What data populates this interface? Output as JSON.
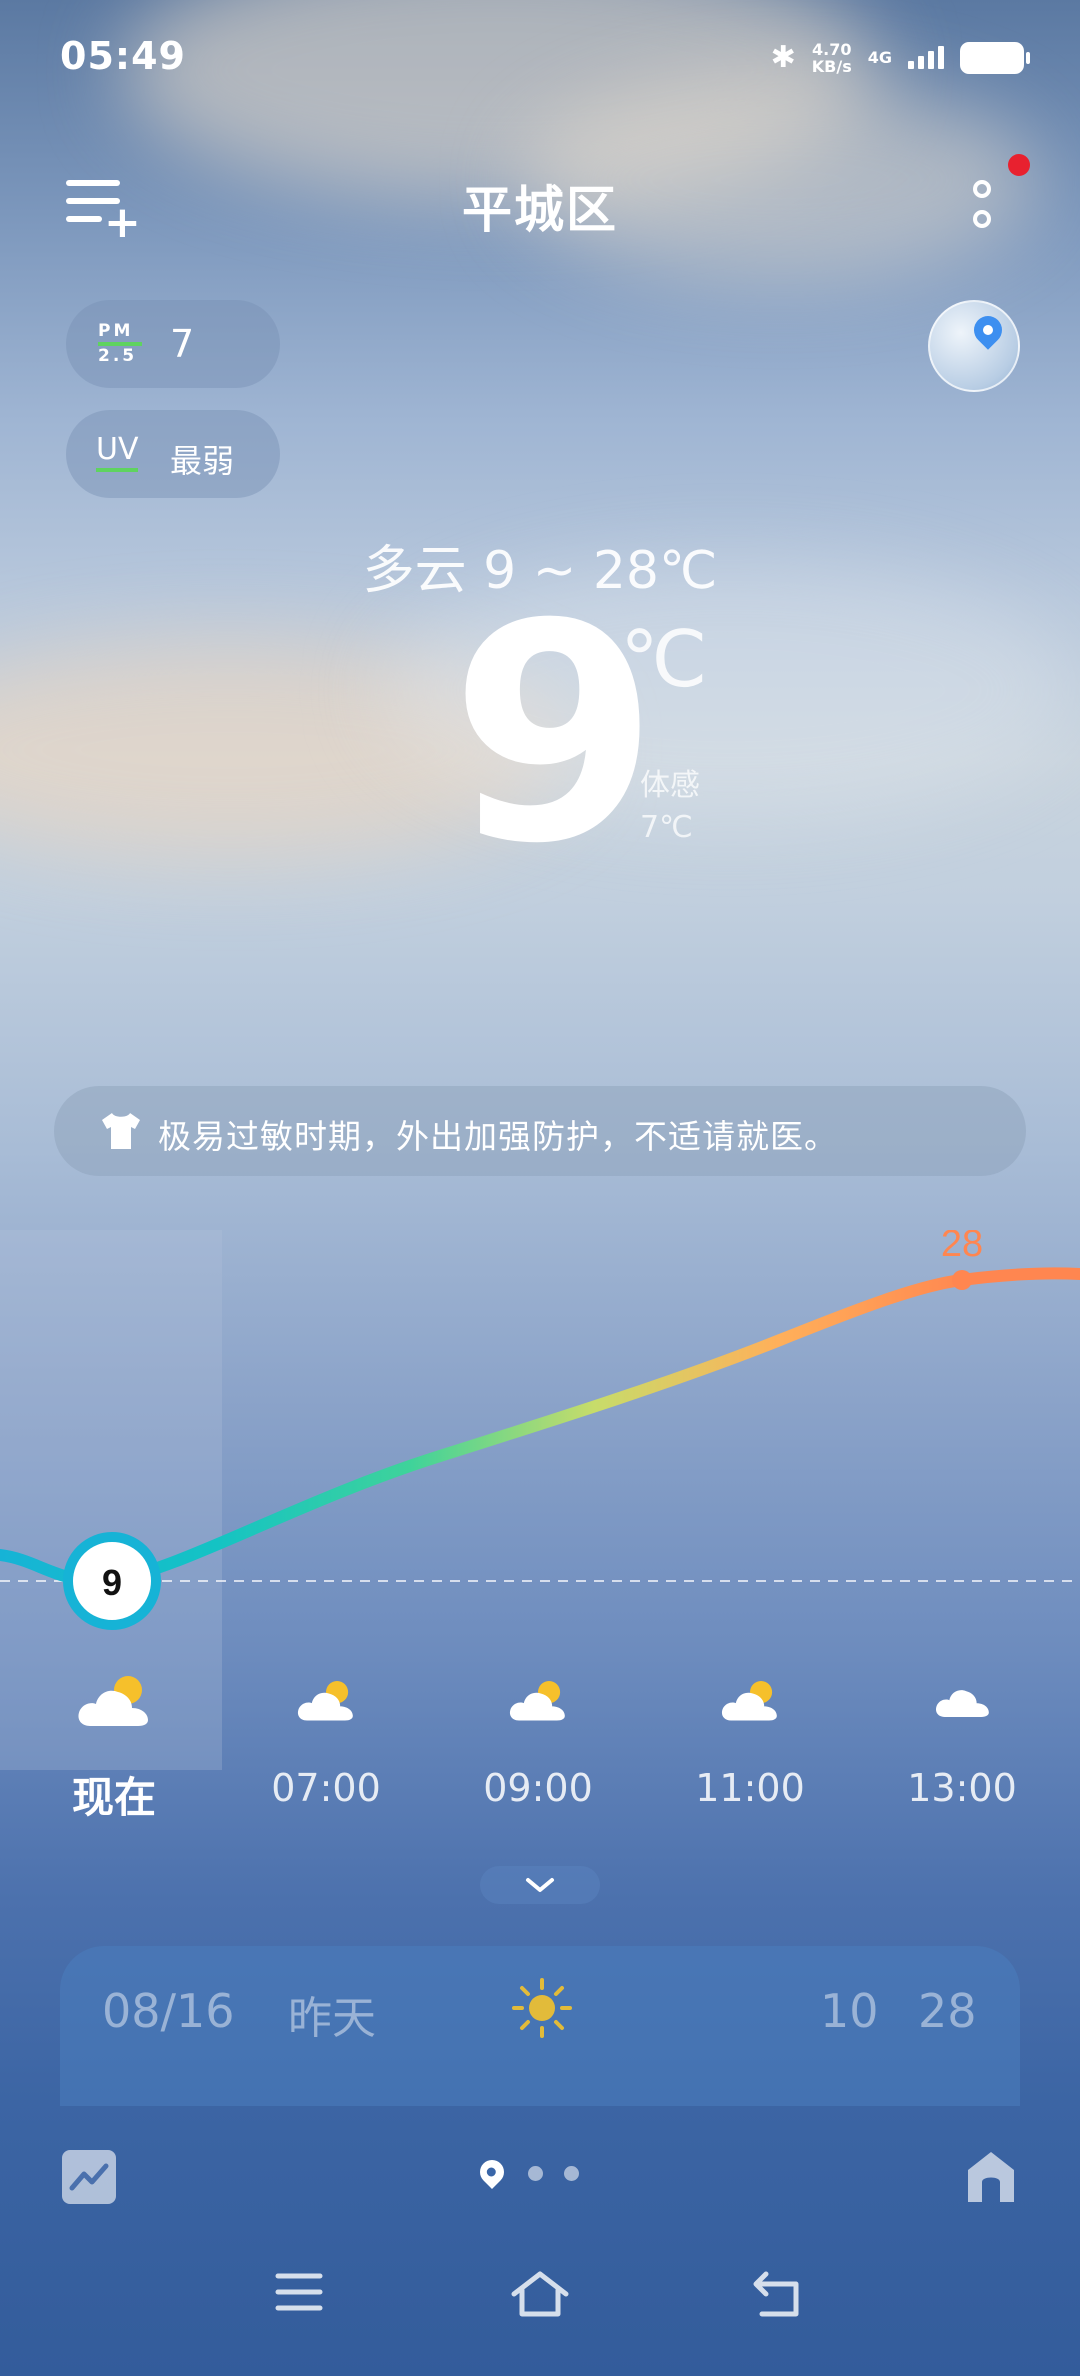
{
  "status_bar": {
    "time": "05:49",
    "speed_value": "4.70",
    "speed_unit": "KB/s",
    "network": "4G"
  },
  "header": {
    "city": "平城区"
  },
  "air": {
    "pm_label_top": "PM",
    "pm_label_bottom": "2.5",
    "pm_value": "7",
    "uv_label": "UV",
    "uv_value": "最弱"
  },
  "current": {
    "summary": "多云  9 ~ 28℃",
    "temp": "9",
    "unit": "℃",
    "feels_label": "体感",
    "feels_value": "7℃"
  },
  "tip": {
    "text": "极易过敏时期，外出加强防护，不适请就医。"
  },
  "hourly": {
    "now_temp": "9",
    "max_temp": "28",
    "labels": [
      "现在",
      "07:00",
      "09:00",
      "11:00",
      "13:00"
    ],
    "icons": [
      "partly-cloudy-icon",
      "partly-cloudy-icon",
      "partly-cloudy-icon",
      "partly-cloudy-icon",
      "cloud-icon"
    ]
  },
  "daily": {
    "date": "08/16",
    "day": "昨天",
    "icon": "sun-icon",
    "low": "10",
    "high": "28"
  },
  "colors": {
    "curve_start": "#16b3d6",
    "curve_mid": "#3fd39a",
    "curve_end": "#ff8650",
    "accent_red": "#e8212f",
    "pm_green": "#5fd35f"
  }
}
